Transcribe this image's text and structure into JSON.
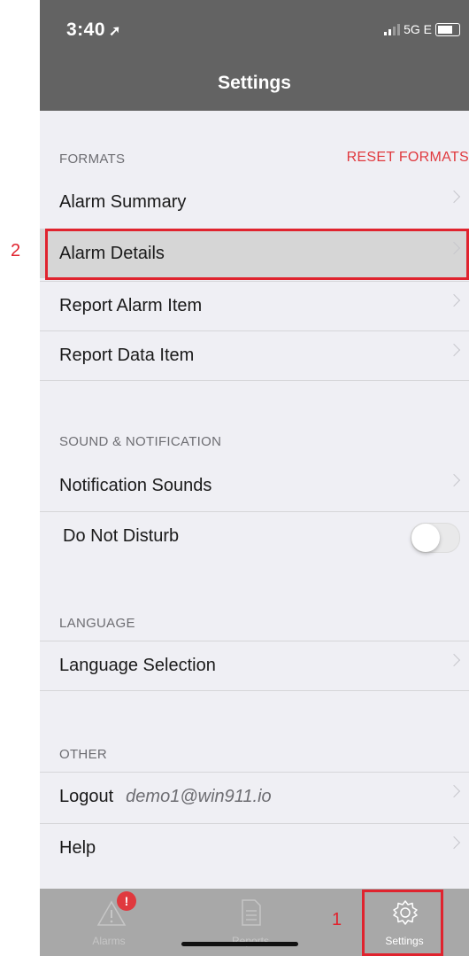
{
  "status_bar": {
    "time": "3:40",
    "network": "5G E"
  },
  "header": {
    "title": "Settings"
  },
  "sections": {
    "formats": {
      "label": "FORMATS",
      "action": "RESET FORMATS",
      "items": [
        "Alarm Summary",
        "Alarm Details",
        "Report Alarm Item",
        "Report Data Item"
      ]
    },
    "sound": {
      "label": "SOUND & NOTIFICATION",
      "items": [
        "Notification Sounds",
        "Do Not Disturb"
      ],
      "do_not_disturb_on": false
    },
    "language": {
      "label": "LANGUAGE",
      "items": [
        "Language Selection"
      ]
    },
    "other": {
      "label": "OTHER",
      "logout_label": "Logout",
      "logout_email": "demo1@win911.io",
      "help_label": "Help"
    }
  },
  "tabbar": {
    "tabs": [
      "Alarms",
      "Reports",
      "Settings"
    ],
    "alarms_badge": "!",
    "active": "Settings"
  },
  "annotations": {
    "step1": "1",
    "step2": "2"
  },
  "colors": {
    "accent": "#e0393e",
    "header": "#636363",
    "annotation": "#e0232e"
  }
}
